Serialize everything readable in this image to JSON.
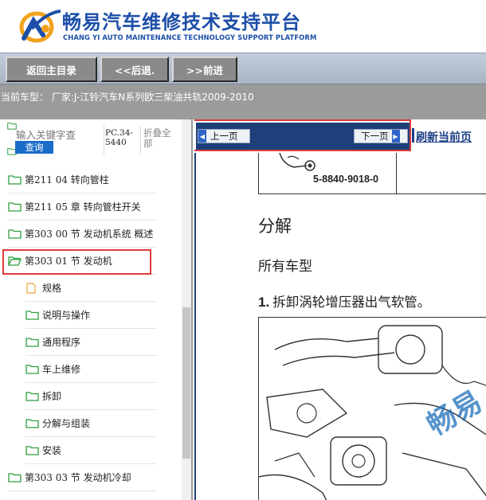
{
  "header": {
    "title": "畅易汽车维修技术支持平台",
    "subtitle": "CHANG YI AUTO MAINTENANCE TECHNOLOGY SUPPORT PLATFORM",
    "logo_icon": "cy-logo-icon",
    "brand_color": "#1c4fa8"
  },
  "nav": {
    "back_main": "返回主目录",
    "prev": "<<后退.",
    "next": ">>前进"
  },
  "car_info": "当前车型： 厂家:J-江铃汽车N系列欧三柴油共轨2009-2010",
  "sidebar": {
    "search_placeholder": "输入关键字查",
    "search_button": "查询",
    "pc_label": "PC.34-5440",
    "fold_all": "折叠全部",
    "items": [
      {
        "label": "第211 04 转向管柱",
        "icon": "folder-icon"
      },
      {
        "label": "第211 05 章 转向管柱开关",
        "icon": "folder-icon"
      },
      {
        "label": "第303 00 节 发动机系统 概述",
        "icon": "folder-icon"
      },
      {
        "label": "第303 01 节 发动机",
        "icon": "folder-open-icon"
      },
      {
        "label": "规格",
        "icon": "document-icon"
      },
      {
        "label": "说明与操作",
        "icon": "folder-icon"
      },
      {
        "label": "通用程序",
        "icon": "folder-icon"
      },
      {
        "label": "车上维修",
        "icon": "folder-icon"
      },
      {
        "label": "拆卸",
        "icon": "folder-icon"
      },
      {
        "label": "分解与组装",
        "icon": "folder-icon"
      },
      {
        "label": "安装",
        "icon": "folder-icon"
      },
      {
        "label": "第303 03 节 发动机冷却",
        "icon": "folder-icon"
      }
    ],
    "highlight_color": "#e03a3a"
  },
  "pager": {
    "prev_page": "上一页",
    "next_page": "下一页",
    "refresh": "刷新当前页"
  },
  "document": {
    "part_number": "5-8840-9018-0",
    "heading": "分解",
    "subheading": "所有车型",
    "step_number": "1.",
    "step_text": "拆卸涡轮增压器出气软管。",
    "watermark": "畅易"
  }
}
